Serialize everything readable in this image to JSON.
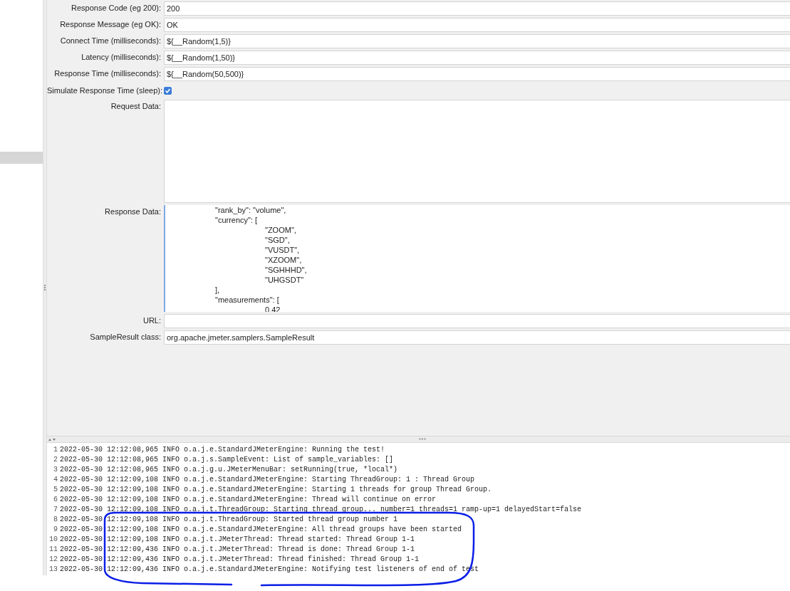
{
  "fields": [
    {
      "kind": "text",
      "label": "Response Code (eg 200):",
      "value": "200"
    },
    {
      "kind": "text",
      "label": "Response Message (eg OK):",
      "value": "OK"
    },
    {
      "kind": "text",
      "label": "Connect Time (milliseconds):",
      "value": "${__Random(1,5)}"
    },
    {
      "kind": "text",
      "label": "Latency (milliseconds):",
      "value": "${__Random(1,50)}"
    },
    {
      "kind": "text",
      "label": "Response Time (milliseconds):",
      "value": "${__Random(50,500)}"
    },
    {
      "kind": "checkbox",
      "label": "Simulate Response Time (sleep):",
      "checked": true
    },
    {
      "kind": "textarea",
      "label": "Request Data:"
    },
    {
      "kind": "code",
      "label": "Response Data:",
      "lines": [
        {
          "text": "\"rank_by\": \"volume\","
        },
        {
          "text": "\"currency\": [",
          "children": [
            {
              "text": "\"ZOOM\","
            },
            {
              "text": "\"SGD\","
            },
            {
              "text": "\"VUSDT\","
            },
            {
              "text": "\"XZOOM\","
            },
            {
              "text": "\"SGHHHD\","
            },
            {
              "text": "\"UHGSDT\""
            }
          ]
        },
        {
          "text": "],"
        },
        {
          "text": "\"measurements\": [",
          "children": [
            {
              "text": "0.42"
            }
          ]
        }
      ]
    },
    {
      "kind": "text",
      "label": "URL:"
    },
    {
      "kind": "text",
      "label": "SampleResult class:",
      "value": "org.apache.jmeter.samplers.SampleResult"
    }
  ],
  "log": [
    {
      "number": "1",
      "text": "2022-05-30 12:12:08,965 INFO o.a.j.e.StandardJMeterEngine: Running the test!"
    },
    {
      "number": "2",
      "text": "2022-05-30 12:12:08,965 INFO o.a.j.s.SampleEvent: List of sample_variables: []"
    },
    {
      "number": "3",
      "text": "2022-05-30 12:12:08,965 INFO o.a.j.g.u.JMeterMenuBar: setRunning(true, *local*)"
    },
    {
      "number": "4",
      "text": "2022-05-30 12:12:09,108 INFO o.a.j.e.StandardJMeterEngine: Starting ThreadGroup: 1 : Thread Group"
    },
    {
      "number": "5",
      "text": "2022-05-30 12:12:09,108 INFO o.a.j.e.StandardJMeterEngine: Starting 1 threads for group Thread Group."
    },
    {
      "number": "6",
      "text": "2022-05-30 12:12:09,108 INFO o.a.j.e.StandardJMeterEngine: Thread will continue on error"
    },
    {
      "number": "7",
      "text": "2022-05-30 12:12:09,108 INFO o.a.j.t.ThreadGroup: Starting thread group... number=1 threads=1 ramp-up=1 delayedStart=false"
    },
    {
      "number": "8",
      "text": "2022-05-30 12:12:09,108 INFO o.a.j.t.ThreadGroup: Started thread group number 1"
    },
    {
      "number": "9",
      "text": "2022-05-30 12:12:09,108 INFO o.a.j.e.StandardJMeterEngine: All thread groups have been started"
    },
    {
      "number": "10",
      "text": "2022-05-30 12:12:09,108 INFO o.a.j.t.JMeterThread: Thread started: Thread Group 1-1"
    },
    {
      "number": "11",
      "text": "2022-05-30 12:12:09,436 INFO o.a.j.t.JMeterThread: Thread is done: Thread Group 1-1"
    },
    {
      "number": "12",
      "text": "2022-05-30 12:12:09,436 INFO o.a.j.t.JMeterThread: Thread finished: Thread Group 1-1"
    },
    {
      "number": "13",
      "text": "2022-05-30 12:12:09,436 INFO o.a.j.e.StandardJMeterEngine: Notifying test listeners of end of test"
    }
  ]
}
